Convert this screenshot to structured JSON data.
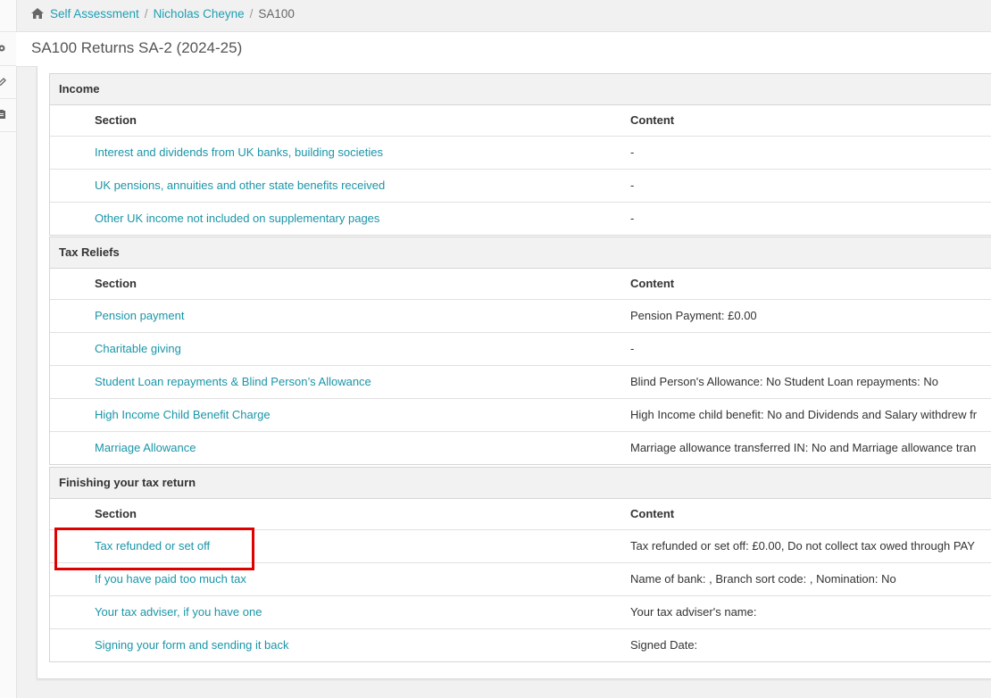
{
  "breadcrumb": {
    "items": [
      "Self Assessment",
      "Nicholas Cheyne"
    ],
    "separator": "/",
    "current": "SA100"
  },
  "page": {
    "title": "SA100 Returns SA-2 (2024-25)"
  },
  "colors": {
    "link": "#1a95a8",
    "highlight": "#e00000",
    "group_header_bg": "#f2f2f2"
  },
  "sidebar": {
    "icons": [
      "gear-icon",
      "edit-icon",
      "clipboard-icon"
    ]
  },
  "groups": {
    "income": {
      "title": "Income",
      "columns": [
        "Section",
        "Content"
      ],
      "rows": [
        {
          "section": "Interest and dividends from UK banks, building societies",
          "content": "-"
        },
        {
          "section": "UK pensions, annuities and other state benefits received",
          "content": "-"
        },
        {
          "section": "Other UK income not included on supplementary pages",
          "content": "-"
        }
      ]
    },
    "reliefs": {
      "title": "Tax Reliefs",
      "columns": [
        "Section",
        "Content"
      ],
      "rows": [
        {
          "section": "Pension payment",
          "content": "Pension Payment: £0.00"
        },
        {
          "section": "Charitable giving",
          "content": "-"
        },
        {
          "section": "Student Loan repayments & Blind Person’s Allowance",
          "content": "Blind Person's Allowance: No Student Loan repayments: No"
        },
        {
          "section": "High Income Child Benefit Charge",
          "content": "High Income child benefit: No and Dividends and Salary withdrew fr"
        },
        {
          "section": "Marriage Allowance",
          "content": "Marriage allowance transferred IN: No and Marriage allowance tran"
        }
      ]
    },
    "finishing": {
      "title": "Finishing your tax return",
      "columns": [
        "Section",
        "Content"
      ],
      "rows": [
        {
          "section": "Tax refunded or set off",
          "content": "Tax refunded or set off: £0.00, Do not collect tax owed through PAY"
        },
        {
          "section": "If you have paid too much tax",
          "content": "Name of bank: , Branch sort code: , Nomination: No"
        },
        {
          "section": "Your tax adviser, if you have one",
          "content": "Your tax adviser's name:"
        },
        {
          "section": "Signing your form and sending it back",
          "content": "Signed Date:"
        }
      ]
    }
  }
}
